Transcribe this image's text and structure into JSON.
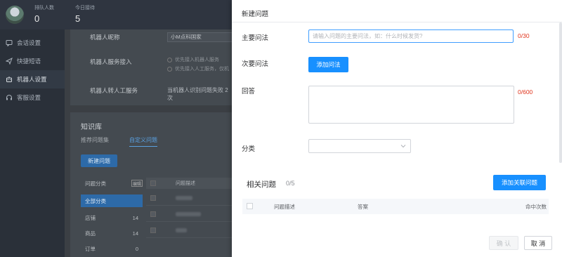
{
  "topbar": {
    "queue_label": "排队人数",
    "queue_value": "0",
    "today_label": "今日接待",
    "today_value": "5"
  },
  "sidebar": {
    "items": [
      {
        "label": "会话设置",
        "icon": "chat-settings-icon"
      },
      {
        "label": "快捷短语",
        "icon": "send-icon"
      },
      {
        "label": "机器人设置",
        "icon": "robot-icon"
      },
      {
        "label": "客服设置",
        "icon": "headset-icon"
      }
    ]
  },
  "robot": {
    "name_label": "机器人昵称",
    "name_value": "小M点科国家",
    "service_label": "机器人服务接入",
    "option1": "优先接入机器人服务",
    "option2": "优先接入人工服务，仅机",
    "transfer_label": "机器人转人工服务",
    "transfer_value": "当机器人识别问题失败 2 次"
  },
  "knowledge": {
    "title": "知识库",
    "tab_recommended": "推荐问题集",
    "tab_custom": "自定义问题",
    "new_button": "新建问题",
    "category_header": "问题分类",
    "edit_label": "编辑",
    "table_header": "问题描述",
    "categories": [
      {
        "name": "全部分类",
        "count": ""
      },
      {
        "name": "店铺",
        "count": "14"
      },
      {
        "name": "商品",
        "count": "14"
      },
      {
        "name": "订单",
        "count": "0"
      }
    ]
  },
  "dialog": {
    "title": "新建问题",
    "primary_label": "主要问法",
    "primary_placeholder": "请输入问题的主要问法，如：什么时候发货?",
    "primary_counter": "0/30",
    "secondary_label": "次要问法",
    "add_button": "添加问法",
    "answer_label": "回答",
    "answer_counter": "0/600",
    "category_label": "分类",
    "related_title": "相关问题",
    "related_count": "0/5",
    "add_related_button": "添加关联问题",
    "columns": [
      "问题描述",
      "答案",
      "命中次数"
    ],
    "confirm_button": "确 认",
    "cancel_button": "取 消"
  },
  "colors": {
    "primary": "#1890ff",
    "error": "#e0341c",
    "focus_border": "#409eff"
  }
}
